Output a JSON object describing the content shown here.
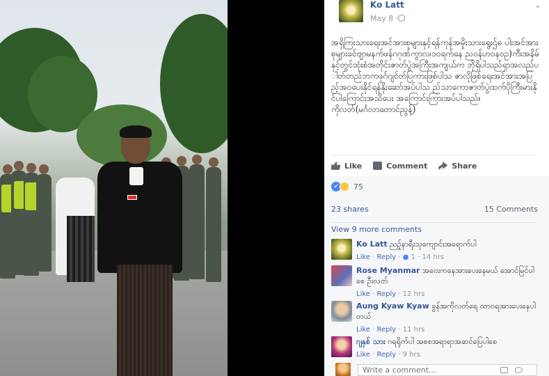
{
  "post": {
    "poster_name": "Ko Latt",
    "date": "May 8 ·",
    "text": "အရှိကြးသားရေးအင်အားစုများနှင့်ရန်ကုန်အမှိုးသားရွေးဌ်ဓ ပါးအင်အားစုများခင်ဗျာမနက်ဖန်ဂဂုဏ်ကွာလ၊၁၀ရက်နေ ညဝန်ဟဝနဝဥ)ကီးအနိမ်နှင့်တွင်ထုံးစံအတိုင်းဇာတ်ပွဲအကြီးအကျယ်က ဘိုရှိပါသည်ရှာအလည်ပါတ်တည်ဘကဖုဂ်ဂျင်တ်ပြကားဖြစ်ပါသ ဇာလိုဖြစ်ရေးအင်အားအပြည့်အဝပေးနိုင်ရန်နိုးဆော်အပ်ပါသ ည်သာကောဇာတ်ပွဲထက်ပိုကြီးမားနိုင်ပါကြောင်းအသိပေး အကြောင်းကြားအပ်ပါသည်။\nကိုလတ်(မင်္ဂလာတောင်ညွန့်)",
    "actions": {
      "like": "Like",
      "comment": "Comment",
      "share": "Share"
    },
    "reaction_count": "75",
    "shares": "23 shares",
    "comments_count": "15 Comments",
    "view_more": "View 9 more comments"
  },
  "comments": [
    {
      "name": "Ko Latt",
      "text": "ညဉ့်နာရီးသုကျောင်းအရောက်ပါ",
      "like": "Like",
      "reply": "Reply",
      "likes": "1",
      "time": "14 hrs"
    },
    {
      "name": "Rose Myanmar",
      "text": "အဝေးကနေအားပေးနေမယ် အောင်မြင်ပါစေ ဦးလတ်",
      "like": "Like",
      "reply": "Reply",
      "time": "12 hrs"
    },
    {
      "name": "Aung Kyaw Kyaw",
      "text": "ခွန်အကိုလတ်ရေ ထာဝရအားပေးနေပါတယ်",
      "like": "Like",
      "reply": "Reply",
      "time": "11 hrs"
    },
    {
      "name": "ဂျနှစ် သား",
      "text": "ဂရရိုက်ပါ အစစအရာရာအဆင်ပြေပါစေ",
      "like": "Like",
      "reply": "Reply",
      "time": "9 hrs"
    }
  ],
  "composer": {
    "placeholder": "Write a comment..."
  },
  "colors": {
    "link": "#365899",
    "meta": "#90949c",
    "reaction_like": "#4a84f8",
    "reaction_haha": "#f7c93e"
  },
  "icons": [
    "globe-icon",
    "chevron-down-icon",
    "like-icon",
    "comment-icon",
    "share-icon",
    "camera-icon",
    "emoji-icon"
  ]
}
